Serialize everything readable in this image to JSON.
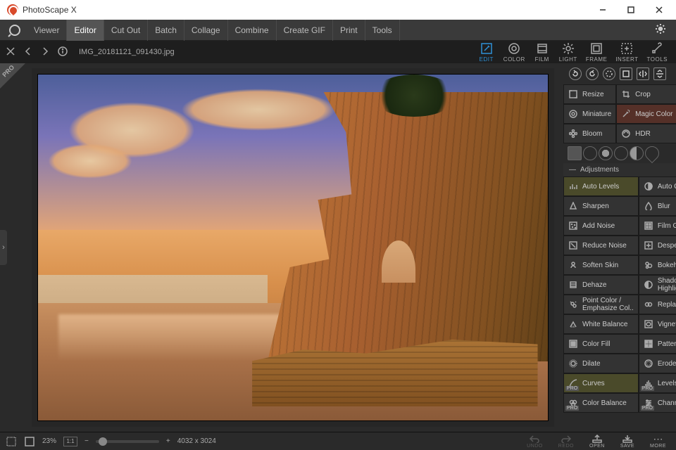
{
  "app": {
    "title": "PhotoScape X"
  },
  "window": {
    "min": "—",
    "max": "☐",
    "close": "✕"
  },
  "menu": {
    "items": [
      "Viewer",
      "Editor",
      "Cut Out",
      "Batch",
      "Collage",
      "Combine",
      "Create GIF",
      "Print",
      "Tools"
    ],
    "active_index": 1
  },
  "subbar": {
    "filename": "IMG_20181121_091430.jpg",
    "tools": [
      {
        "key": "edit",
        "label": "Edit",
        "active": true
      },
      {
        "key": "color",
        "label": "Color"
      },
      {
        "key": "film",
        "label": "Film"
      },
      {
        "key": "light",
        "label": "Light"
      },
      {
        "key": "frame",
        "label": "Frame"
      },
      {
        "key": "insert",
        "label": "Insert"
      },
      {
        "key": "tools",
        "label": "Tools"
      }
    ]
  },
  "panel": {
    "transform": [
      {
        "key": "resize",
        "label": "Resize"
      },
      {
        "key": "crop",
        "label": "Crop"
      },
      {
        "key": "miniature",
        "label": "Miniature"
      },
      {
        "key": "magic-color",
        "label": "Magic Color",
        "active": true
      },
      {
        "key": "bloom",
        "label": "Bloom"
      },
      {
        "key": "hdr",
        "label": "HDR"
      }
    ],
    "section_label": "Adjustments",
    "adjustments": [
      {
        "key": "auto-levels",
        "label": "Auto Levels",
        "hl": true
      },
      {
        "key": "auto-contrast",
        "label": "Auto Contrast"
      },
      {
        "key": "sharpen",
        "label": "Sharpen"
      },
      {
        "key": "blur",
        "label": "Blur"
      },
      {
        "key": "add-noise",
        "label": "Add Noise"
      },
      {
        "key": "film-grain",
        "label": "Film Grain"
      },
      {
        "key": "reduce-noise",
        "label": "Reduce Noise"
      },
      {
        "key": "despeckle",
        "label": "Despeckle"
      },
      {
        "key": "soften-skin",
        "label": "Soften Skin"
      },
      {
        "key": "bokeh-blur",
        "label": "Bokeh Blur"
      },
      {
        "key": "dehaze",
        "label": "Dehaze"
      },
      {
        "key": "shadows-highlights",
        "label": "Shadows/\nHighlights"
      },
      {
        "key": "point-color",
        "label": "Point Color /\nEmphasize Col.."
      },
      {
        "key": "replace-color",
        "label": "Replace Color"
      },
      {
        "key": "white-balance",
        "label": "White Balance"
      },
      {
        "key": "vignette",
        "label": "Vignette"
      },
      {
        "key": "color-fill",
        "label": "Color Fill"
      },
      {
        "key": "pattern-fill",
        "label": "Pattern Fill"
      },
      {
        "key": "dilate",
        "label": "Dilate"
      },
      {
        "key": "erode",
        "label": "Erode"
      },
      {
        "key": "curves",
        "label": "Curves",
        "pro": true,
        "hl": true
      },
      {
        "key": "levels",
        "label": "Levels",
        "pro": true
      },
      {
        "key": "color-balance",
        "label": "Color Balance",
        "pro": true
      },
      {
        "key": "channel-mixer",
        "label": "Channel Mixer",
        "pro": true
      }
    ]
  },
  "bottom": {
    "zoom_pct": "23%",
    "fit_label": "1:1",
    "minus": "−",
    "plus": "+",
    "dims": "4032 x 3024",
    "undo": "UNDO",
    "redo": "REDO",
    "open": "OPEN",
    "save": "SAVE",
    "more": "MORE"
  },
  "ribbon": {
    "pro": "PRO"
  }
}
